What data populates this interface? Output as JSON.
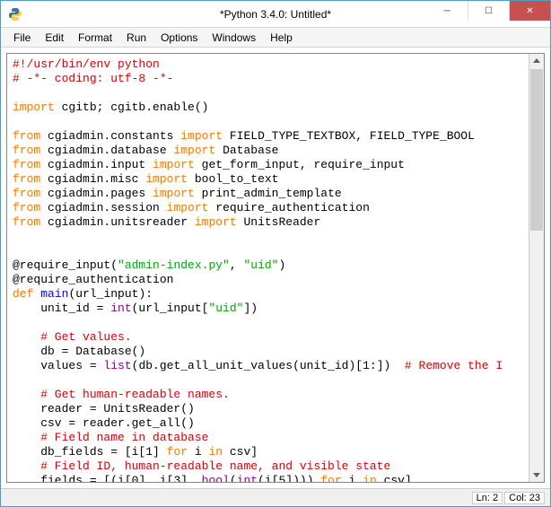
{
  "window": {
    "title": "*Python 3.4.0: Untitled*"
  },
  "menu": {
    "file": "File",
    "edit": "Edit",
    "format": "Format",
    "run": "Run",
    "options": "Options",
    "windows": "Windows",
    "help": "Help"
  },
  "code": {
    "l1": "#!/usr/bin/env python",
    "l2": "# -*- coding: utf-8 -*-",
    "l3": "",
    "l4_a": "import",
    "l4_b": " cgitb; cgitb.enable()",
    "l5": "",
    "l6_a": "from",
    "l6_b": " cgiadmin.constants ",
    "l6_c": "import",
    "l6_d": " FIELD_TYPE_TEXTBOX, FIELD_TYPE_BOOL",
    "l7_a": "from",
    "l7_b": " cgiadmin.database ",
    "l7_c": "import",
    "l7_d": " Database",
    "l8_a": "from",
    "l8_b": " cgiadmin.input ",
    "l8_c": "import",
    "l8_d": " get_form_input, require_input",
    "l9_a": "from",
    "l9_b": " cgiadmin.misc ",
    "l9_c": "import",
    "l9_d": " bool_to_text",
    "l10_a": "from",
    "l10_b": " cgiadmin.pages ",
    "l10_c": "import",
    "l10_d": " print_admin_template",
    "l11_a": "from",
    "l11_b": " cgiadmin.session ",
    "l11_c": "import",
    "l11_d": " require_authentication",
    "l12_a": "from",
    "l12_b": " cgiadmin.unitsreader ",
    "l12_c": "import",
    "l12_d": " UnitsReader",
    "l13": "",
    "l14": "",
    "l15_a": "@require_input",
    "l15_b": "(",
    "l15_c": "\"admin-index.py\"",
    "l15_d": ", ",
    "l15_e": "\"uid\"",
    "l15_f": ")",
    "l16": "@require_authentication",
    "l17_a": "def",
    "l17_b": " ",
    "l17_c": "main",
    "l17_d": "(url_input):",
    "l18_a": "    unit_id = ",
    "l18_b": "int",
    "l18_c": "(url_input[",
    "l18_d": "\"uid\"",
    "l18_e": "])",
    "l19": "",
    "l20": "    # Get values.",
    "l21": "    db = Database()",
    "l22_a": "    values = ",
    "l22_b": "list",
    "l22_c": "(db.get_all_unit_values(unit_id)[",
    "l22_d": "1",
    "l22_e": ":])  ",
    "l22_f": "# Remove the I",
    "l23": "",
    "l24": "    # Get human-readable names.",
    "l25": "    reader = UnitsReader()",
    "l26": "    csv = reader.get_all()",
    "l27": "    # Field name in database",
    "l28_a": "    db_fields = [i[",
    "l28_b": "1",
    "l28_c": "] ",
    "l28_d": "for",
    "l28_e": " i ",
    "l28_f": "in",
    "l28_g": " csv]",
    "l29": "    # Field ID, human-readable name, and visible state",
    "l30_a": "    fields = [(i[",
    "l30_b": "0",
    "l30_c": "], i[",
    "l30_d": "3",
    "l30_e": "], ",
    "l30_f": "bool",
    "l30_g": "(",
    "l30_h": "int",
    "l30_i": "(i[",
    "l30_j": "5",
    "l30_k": "]))) ",
    "l30_l": "for",
    "l30_m": " i ",
    "l30_n": "in",
    "l30_o": " csv]"
  },
  "status": {
    "line": "Ln: 2",
    "col": "Col: 23"
  }
}
